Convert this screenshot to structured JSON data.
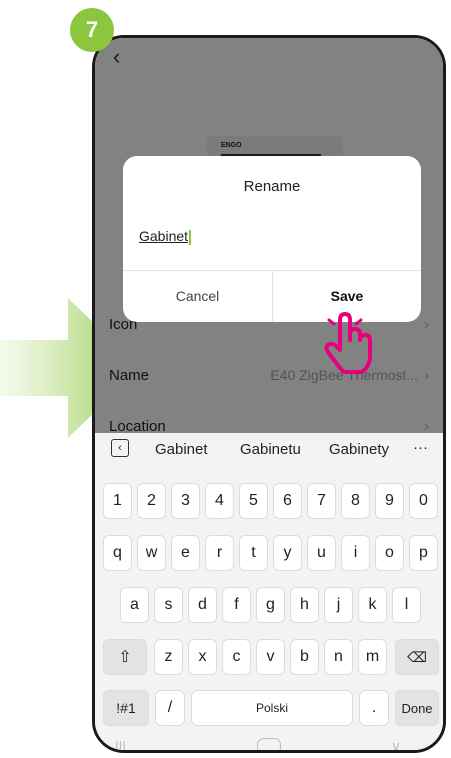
{
  "step_badge": "7",
  "device_label": "ENGO",
  "settings_rows": [
    {
      "label": "Icon",
      "value": ""
    },
    {
      "label": "Name",
      "value": "E40 ZigBee Thermost..."
    },
    {
      "label": "Location",
      "value": ""
    }
  ],
  "dialog": {
    "title": "Rename",
    "input_value": "Gabinet",
    "cancel_label": "Cancel",
    "save_label": "Save"
  },
  "keyboard": {
    "suggestions": [
      "Gabinet",
      "Gabinetu",
      "Gabinety"
    ],
    "more_label": "···",
    "row_numbers": [
      "1",
      "2",
      "3",
      "4",
      "5",
      "6",
      "7",
      "8",
      "9",
      "0"
    ],
    "row_1": [
      "q",
      "w",
      "e",
      "r",
      "t",
      "y",
      "u",
      "i",
      "o",
      "p"
    ],
    "row_2": [
      "a",
      "s",
      "d",
      "f",
      "g",
      "h",
      "j",
      "k",
      "l"
    ],
    "row_3": [
      "z",
      "x",
      "c",
      "v",
      "b",
      "n",
      "m"
    ],
    "symbols_label": "!#1",
    "slash_label": "/",
    "space_label": "Polski",
    "period_label": ".",
    "done_label": "Done"
  },
  "colors": {
    "accent": "#8cc63f",
    "highlight": "#e6007e"
  }
}
